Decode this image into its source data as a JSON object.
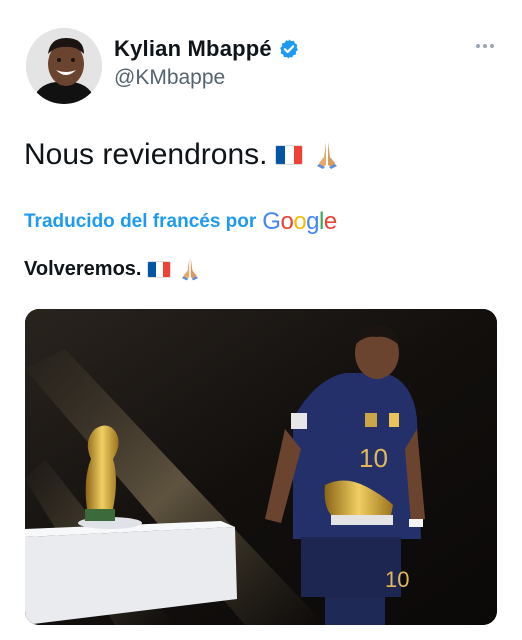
{
  "user": {
    "display_name": "Kylian Mbappé",
    "handle": "@KMbappe",
    "verified": true,
    "verified_color": "#1d9bf0"
  },
  "tweet": {
    "text": "Nous reviendrons.",
    "emojis": [
      "flag-france",
      "folded-hands"
    ]
  },
  "translation": {
    "label": "Traducido del francés por",
    "provider": "Google",
    "text": "Volveremos.",
    "emojis": [
      "flag-france",
      "folded-hands"
    ]
  },
  "media": {
    "jersey_number": "10"
  },
  "colors": {
    "accent": "#1d9bf0",
    "text": "#0f1419",
    "secondary": "#536471",
    "google": [
      "#4285F4",
      "#EA4335",
      "#FBBC05",
      "#4285F4",
      "#34A853",
      "#EA4335"
    ],
    "france_flag": [
      "#0055A4",
      "#FFFFFF",
      "#EF4135"
    ]
  }
}
